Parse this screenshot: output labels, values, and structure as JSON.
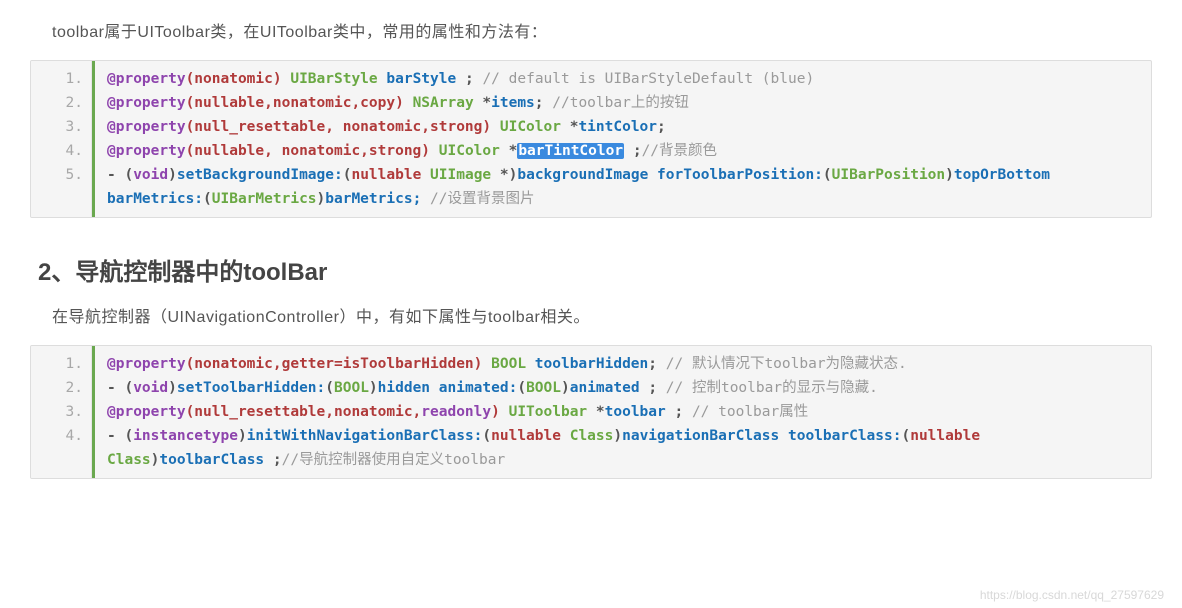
{
  "intro1": "toolbar属于UIToolbar类，在UIToolbar类中，常用的属性和方法有：",
  "heading2": "2、导航控制器中的toolBar",
  "intro2": "在导航控制器（UINavigationController）中，有如下属性与toolbar相关。",
  "watermark": "https://blog.csdn.net/qq_27597629",
  "code1_lines": [
    "1.",
    "2.",
    "3.",
    "4.",
    "5."
  ],
  "code2_lines": [
    "1.",
    "2.",
    "3.",
    "4."
  ],
  "c1": {
    "l1": {
      "kw": "@property",
      "attrs": "(nonatomic)",
      "type": "UIBarStyle",
      "ident": "barStyle",
      "sym": " ; ",
      "cmt": "// default is UIBarStyleDefault (blue)"
    },
    "l2": {
      "kw": "@property",
      "attrs": "(nullable,nonatomic,copy)",
      "type": "NSArray",
      "star": "*",
      "ident": "items",
      "sym": "; ",
      "cmt": "//toolbar上的按钮"
    },
    "l3": {
      "kw": "@property",
      "attrs": "(null_resettable, nonatomic,strong)",
      "type": "UIColor",
      "star": "*",
      "ident": "tintColor",
      "sym": ";"
    },
    "l4": {
      "kw": "@property",
      "attrs": "(nullable, nonatomic,strong)",
      "type": "UIColor",
      "star": "*",
      "hl": "barTintColor",
      "sym": " ;",
      "cmt": "//背景颜色"
    },
    "l5": {
      "dash": "- ",
      "p1": "(",
      "vtype": "void",
      "p2": ")",
      "m1": "setBackgroundImage:",
      "p3": "(",
      "nullable": "nullable ",
      "uimage": "UIImage ",
      "star": "*",
      "p4": ")",
      "arg1": "backgroundImage ",
      "m2": "forToolbarPosition:",
      "p5": "(",
      "uibp": "UIBarPosition",
      "p6": ")",
      "arg2": "topOrBottom ",
      "m3": "barMetrics:",
      "p7": "(",
      "uibm": "UIBarMetrics",
      "p8": ")",
      "arg3": "barMetrics;",
      "sp": " ",
      "cmt": "//设置背景图片"
    }
  },
  "c2": {
    "l1": {
      "kw": "@property",
      "attrs": "(nonatomic,getter=isToolbarHidden)",
      "type": "BOOL",
      "ident": "toolbarHidden",
      "sym": "; ",
      "cmt": "// 默认情况下toolbar为隐藏状态."
    },
    "l2": {
      "dash": "- ",
      "p1": "(",
      "vtype": "void",
      "p2": ")",
      "m1": "setToolbarHidden:",
      "p3": "(",
      "b1": "BOOL",
      "p4": ")",
      "a1": "hidden ",
      "m2": "animated:",
      "p5": "(",
      "b2": "BOOL",
      "p6": ")",
      "a2": "animated ",
      "sym": "; ",
      "cmt": "// 控制toolbar的显示与隐藏."
    },
    "l3": {
      "kw": "@property",
      "attrs_a": "(null_resettable,nonatomic,",
      "ro": "readonly",
      "attrs_b": ")",
      "type": "UIToolbar",
      "star": "*",
      "ident": "toolbar",
      "sym": " ; ",
      "cmt": "// toolbar属性"
    },
    "l4": {
      "dash": "- ",
      "p1": "(",
      "inst": "instancetype",
      "p2": ")",
      "m1": "initWithNavigationBarClass:",
      "p3": "(",
      "nullable": "nullable ",
      "cls1": "Class",
      "p4": ")",
      "a1": "navigationBarClass ",
      "m2": "toolbarClass:",
      "p5": "(",
      "null2": "nullable ",
      "cls2": "Class",
      "p6": ")",
      "a2": "toolbarClass ",
      "sym": ";",
      "cmt": "//导航控制器使用自定义toolbar"
    }
  }
}
